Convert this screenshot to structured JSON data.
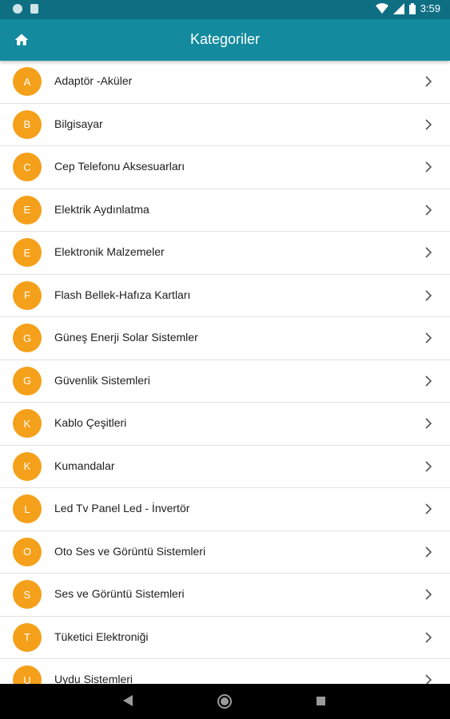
{
  "status_bar": {
    "time": "3:59",
    "icons": [
      "notification-dot-icon",
      "sd-card-icon",
      "wifi-icon",
      "signal-icon",
      "battery-icon"
    ]
  },
  "app_bar": {
    "title": "Kategoriler",
    "home_icon": "home-icon"
  },
  "colors": {
    "status_bar": "#0e6f83",
    "app_bar": "#138a9e",
    "avatar": "#f5a01a"
  },
  "categories": [
    {
      "letter": "A",
      "label": "Adaptör -Aküler"
    },
    {
      "letter": "B",
      "label": "Bilgisayar"
    },
    {
      "letter": "C",
      "label": "Cep Telefonu Aksesuarları"
    },
    {
      "letter": "E",
      "label": "Elektrik Aydınlatma"
    },
    {
      "letter": "E",
      "label": "Elektronik Malzemeler"
    },
    {
      "letter": "F",
      "label": "Flash Bellek-Hafıza Kartları"
    },
    {
      "letter": "G",
      "label": "Güneş Enerji Solar Sistemler"
    },
    {
      "letter": "G",
      "label": "Güvenlik Sistemleri"
    },
    {
      "letter": "K",
      "label": "Kablo Çeşitleri"
    },
    {
      "letter": "K",
      "label": "Kumandalar"
    },
    {
      "letter": "L",
      "label": "Led Tv Panel Led - İnvertör"
    },
    {
      "letter": "O",
      "label": "Oto Ses ve Görüntü Sistemleri"
    },
    {
      "letter": "S",
      "label": "Ses ve Görüntü Sistemleri"
    },
    {
      "letter": "T",
      "label": "Tüketici Elektroniği"
    },
    {
      "letter": "U",
      "label": "Uydu Sistemleri"
    }
  ],
  "nav_bar": {
    "icons": [
      "back-icon",
      "home-circle-icon",
      "recents-icon"
    ]
  }
}
